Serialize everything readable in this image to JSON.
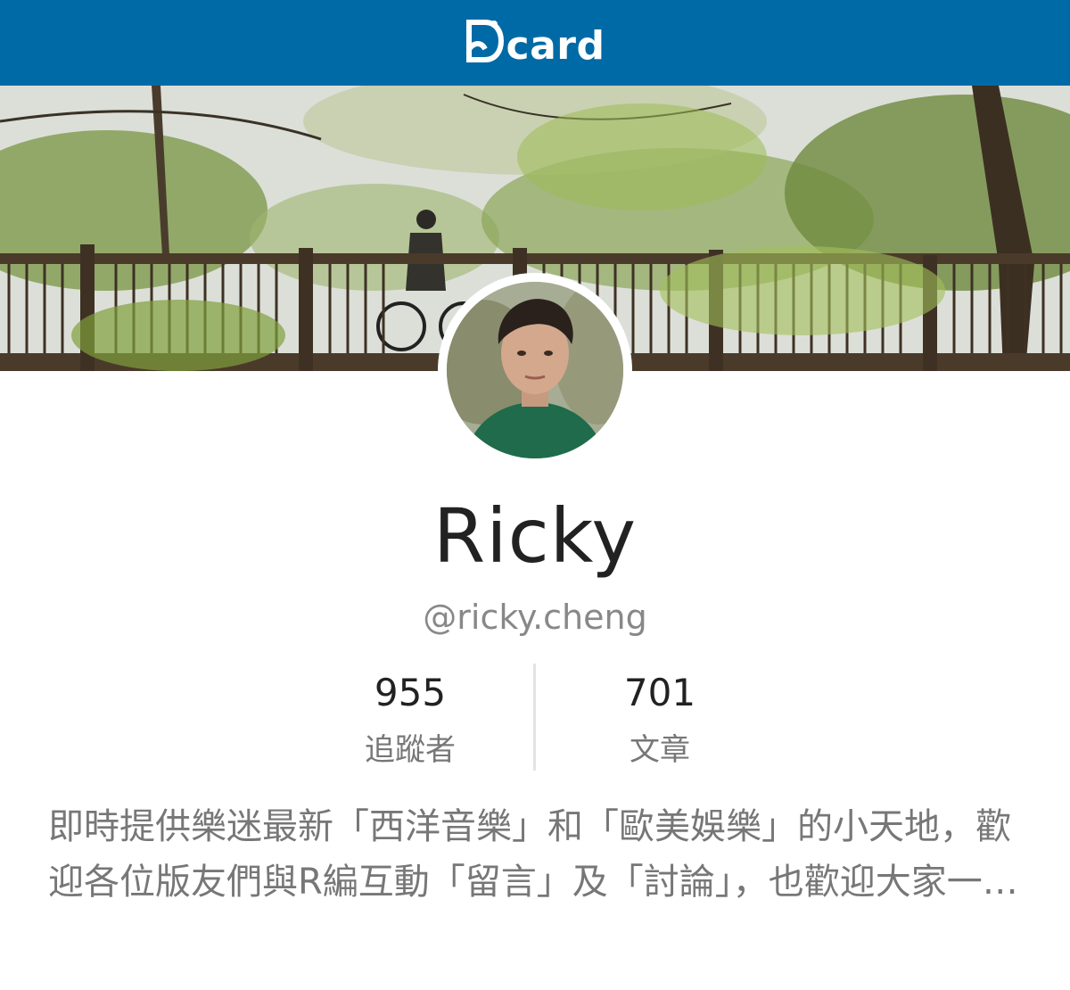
{
  "header": {
    "logo_text": "card",
    "logo_icon": "dcard-d-icon",
    "brand_color": "#006aa6"
  },
  "cover": {
    "image": "cover-photo-park-bridge"
  },
  "profile": {
    "avatar": "avatar-photo",
    "name": "Ricky",
    "handle": "@ricky.cheng",
    "stats": [
      {
        "value": "955",
        "label": "追蹤者"
      },
      {
        "value": "701",
        "label": "文章"
      }
    ],
    "bio": "即時提供樂迷最新「西洋音樂」和「歐美娛樂」的小天地，歡迎各位版友們與R編互動「留言」及「討論」，也歡迎大家一起分享喜愛的音樂與娛樂新聞"
  }
}
